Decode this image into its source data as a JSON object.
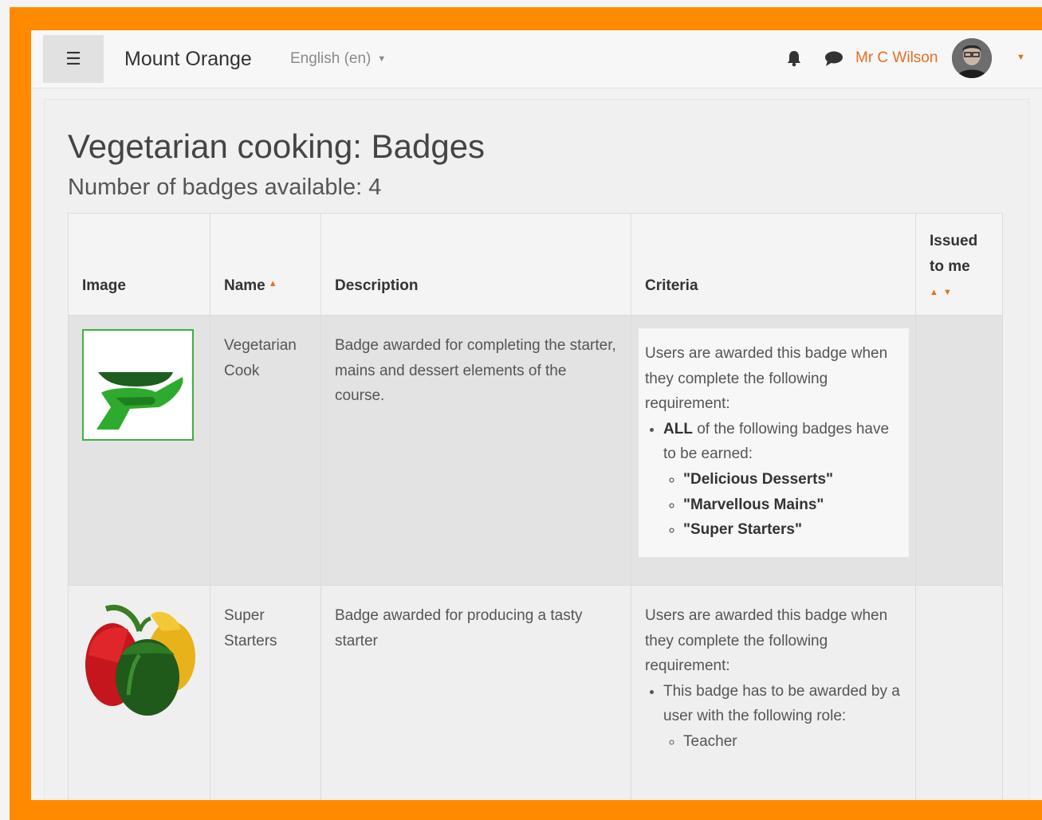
{
  "navbar": {
    "menu_icon": "hamburger-icon",
    "site_name": "Mount Orange",
    "language": "English (en)",
    "user_name": "Mr C Wilson",
    "icons": [
      "bell-icon",
      "chat-icon"
    ],
    "accent": "#e86e1c"
  },
  "page": {
    "title": "Vegetarian cooking: Badges",
    "subtitle": "Number of badges available: 4"
  },
  "table": {
    "headers": {
      "image": "Image",
      "name": "Name",
      "description": "Description",
      "criteria": "Criteria",
      "issued": "Issued to me"
    },
    "rows": [
      {
        "name": "Vegetarian Cook",
        "description": "Badge awarded for completing the starter, mains and dessert elements of the course.",
        "criteria_intro": "Users are awarded this badge when they complete the following requirement:",
        "criteria_item_bold": "ALL",
        "criteria_item_text": " of the following badges have to be earned:",
        "criteria_sub": [
          "\"Delicious Desserts\"",
          "\"Marvellous Mains\"",
          "\"Super Starters\""
        ]
      },
      {
        "name": "Super Starters",
        "description": "Badge awarded for producing a tasty starter",
        "criteria_intro": "Users are awarded this badge when they complete the following requirement:",
        "criteria_item_text": "This badge has to be awarded by a user with the following role:",
        "criteria_sub": [
          "Teacher"
        ]
      }
    ]
  },
  "colors": {
    "frame_orange": "#ff8a00",
    "badge_green": "#3cb043"
  }
}
